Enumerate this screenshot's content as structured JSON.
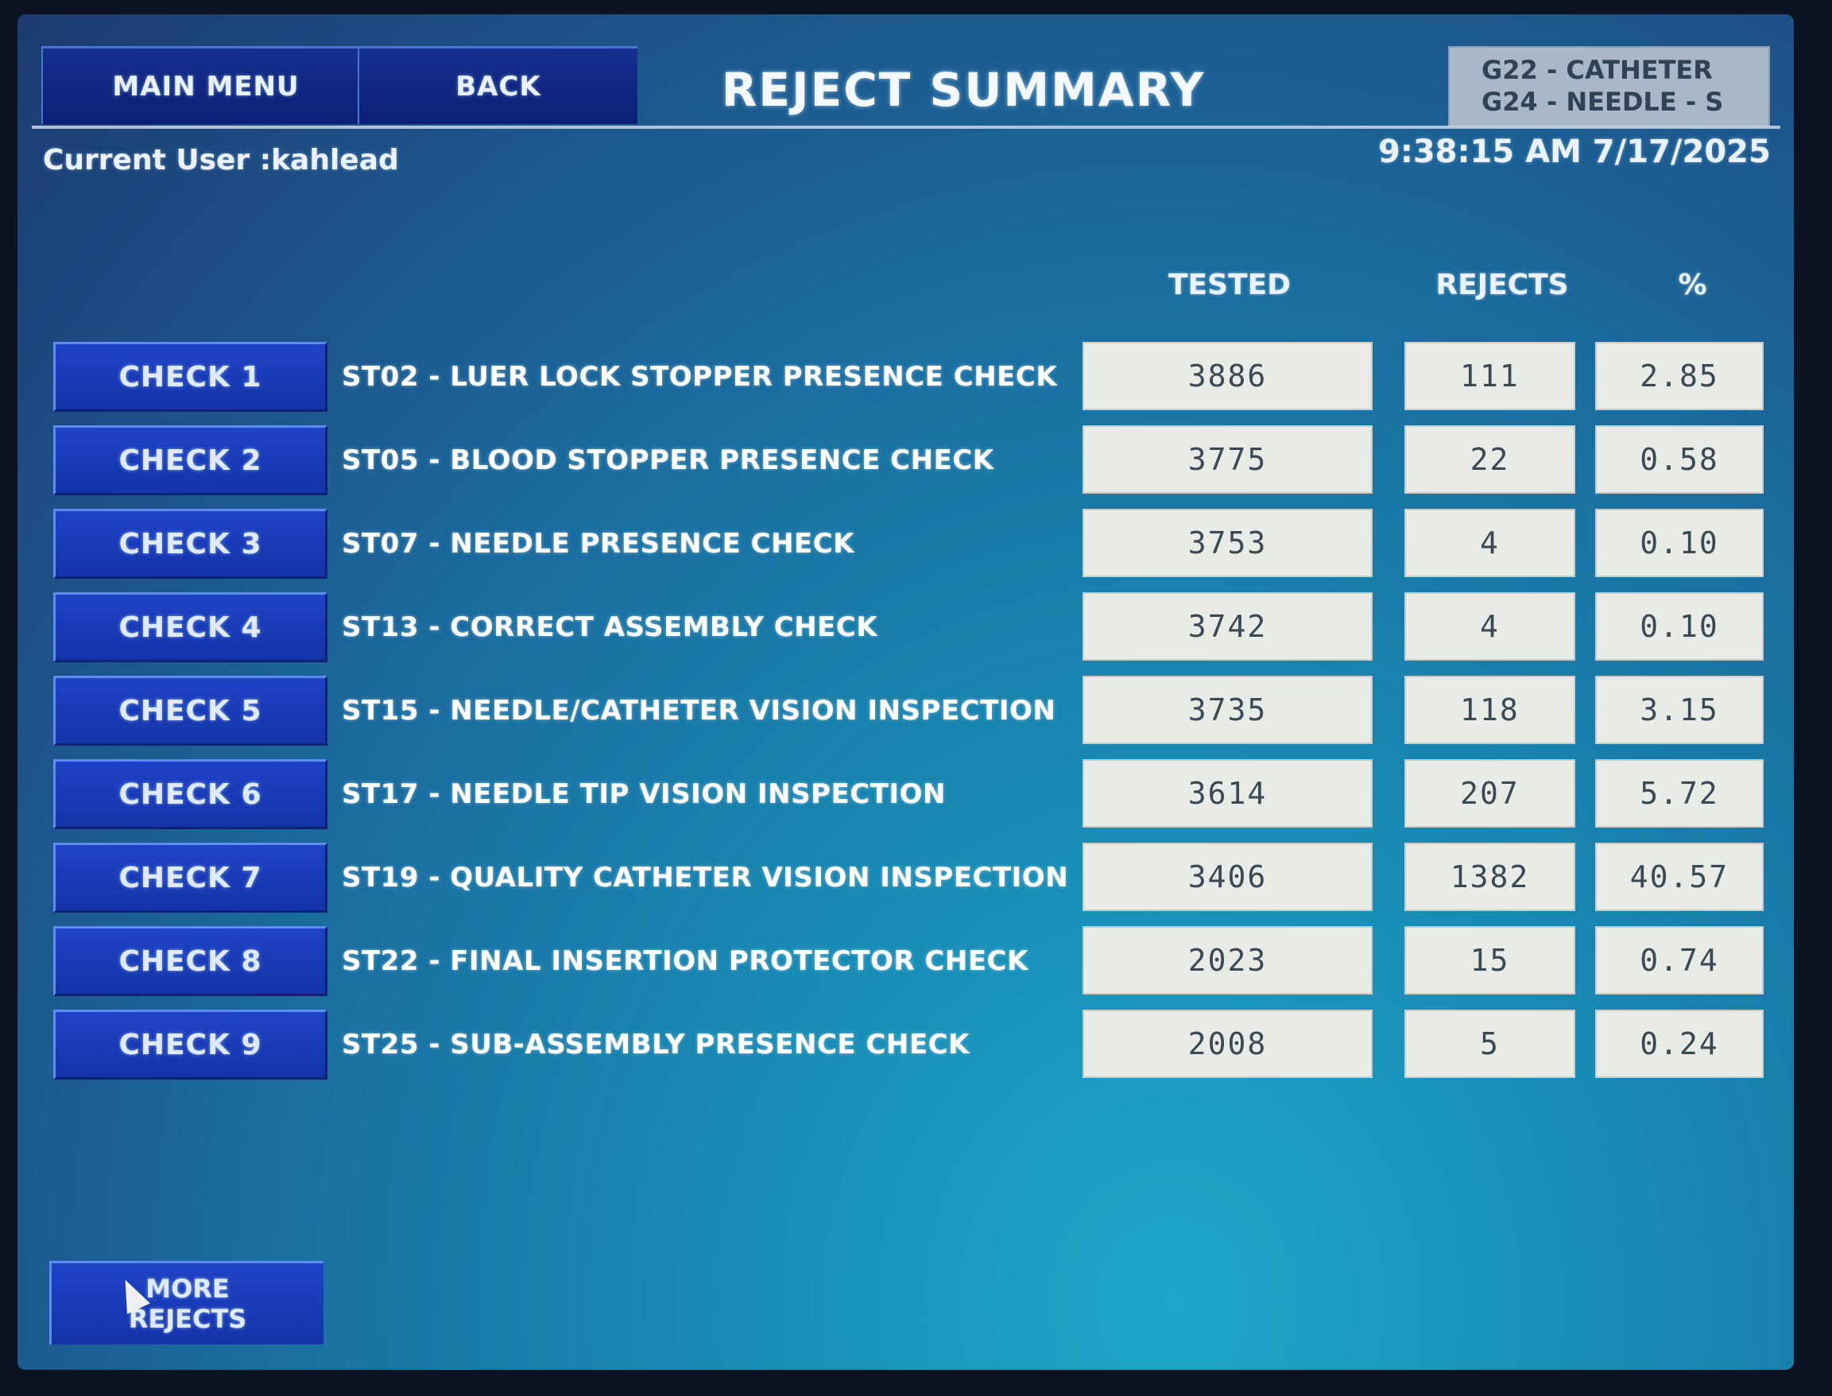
{
  "header": {
    "main_menu_label": "MAIN MENU",
    "back_label": "BACK",
    "title": "REJECT SUMMARY",
    "model_line1": "G22 - CATHETER",
    "model_line2": "G24 - NEEDLE - S"
  },
  "status": {
    "current_user": "Current User :kahlead",
    "datetime": "9:38:15 AM 7/17/2025"
  },
  "table": {
    "columns": {
      "tested": "TESTED",
      "rejects": "REJECTS",
      "percent": "%"
    },
    "rows": [
      {
        "button": "CHECK 1",
        "description": "ST02 - LUER LOCK STOPPER PRESENCE CHECK",
        "tested": "3886",
        "rejects": "111",
        "percent": "2.85"
      },
      {
        "button": "CHECK 2",
        "description": "ST05 - BLOOD STOPPER PRESENCE CHECK",
        "tested": "3775",
        "rejects": "22",
        "percent": "0.58"
      },
      {
        "button": "CHECK 3",
        "description": "ST07 - NEEDLE PRESENCE CHECK",
        "tested": "3753",
        "rejects": "4",
        "percent": "0.10"
      },
      {
        "button": "CHECK 4",
        "description": "ST13 - CORRECT ASSEMBLY CHECK",
        "tested": "3742",
        "rejects": "4",
        "percent": "0.10"
      },
      {
        "button": "CHECK 5",
        "description": "ST15 - NEEDLE/CATHETER VISION INSPECTION",
        "tested": "3735",
        "rejects": "118",
        "percent": "3.15"
      },
      {
        "button": "CHECK 6",
        "description": "ST17 - NEEDLE TIP VISION INSPECTION",
        "tested": "3614",
        "rejects": "207",
        "percent": "5.72"
      },
      {
        "button": "CHECK 7",
        "description": "ST19 - QUALITY CATHETER VISION INSPECTION",
        "tested": "3406",
        "rejects": "1382",
        "percent": "40.57"
      },
      {
        "button": "CHECK 8",
        "description": "ST22 - FINAL INSERTION PROTECTOR CHECK",
        "tested": "2023",
        "rejects": "15",
        "percent": "0.74"
      },
      {
        "button": "CHECK 9",
        "description": "ST25 - SUB-ASSEMBLY PRESENCE CHECK",
        "tested": "2008",
        "rejects": "5",
        "percent": "0.24"
      }
    ]
  },
  "footer": {
    "more_rejects_line1": "MORE",
    "more_rejects_line2": "REJECTS"
  },
  "cursor_icon": "mouse-pointer-icon"
}
